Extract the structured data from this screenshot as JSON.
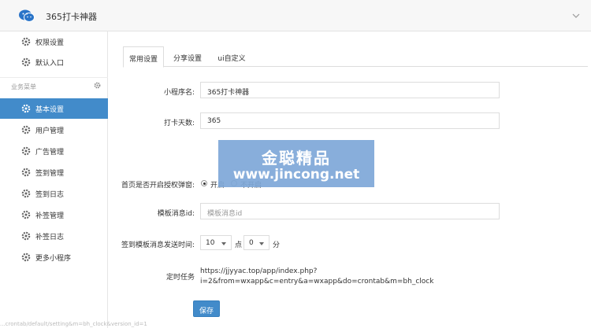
{
  "header": {
    "title": "365打卡神器"
  },
  "sidebar": {
    "top_items": [
      {
        "label": "权限设置",
        "icon": "gear-icon"
      },
      {
        "label": "默认入口",
        "icon": "gear-icon"
      }
    ],
    "section_title": "业务菜单",
    "items": [
      {
        "label": "基本设置",
        "active": true
      },
      {
        "label": "用户管理"
      },
      {
        "label": "广告管理"
      },
      {
        "label": "签到管理"
      },
      {
        "label": "签到日志"
      },
      {
        "label": "补签管理"
      },
      {
        "label": "补签日志"
      },
      {
        "label": "更多小程序"
      }
    ]
  },
  "tabs": [
    "常用设置",
    "分享设置",
    "ui自定义"
  ],
  "form": {
    "app_name_label": "小程序名:",
    "app_name_value": "365打卡神器",
    "days_label": "打卡天数:",
    "days_value": "365",
    "auth_popup_label": "首页是否开启授权弹窗:",
    "auth_on_label": "开启",
    "auth_off_label": "不开启",
    "template_label": "模板消息id:",
    "template_placeholder": "模板消息id",
    "send_time_label": "签到模板消息发送时间:",
    "hour_value": "10",
    "hour_unit": "点",
    "minute_value": "0",
    "minute_unit": "分",
    "cron_label": "定时任务",
    "cron_line1": "https://jjyyac.top/app/index.php?",
    "cron_line2": "i=2&from=wxapp&c=entry&a=wxapp&do=crontab&m=bh_clock",
    "save_label": "保存"
  },
  "watermark": {
    "line1": "金聪精品",
    "line2": "www.jincong.net"
  },
  "statusbar": "...crontab/default/setting&m=bh_clock&version_id=1"
}
